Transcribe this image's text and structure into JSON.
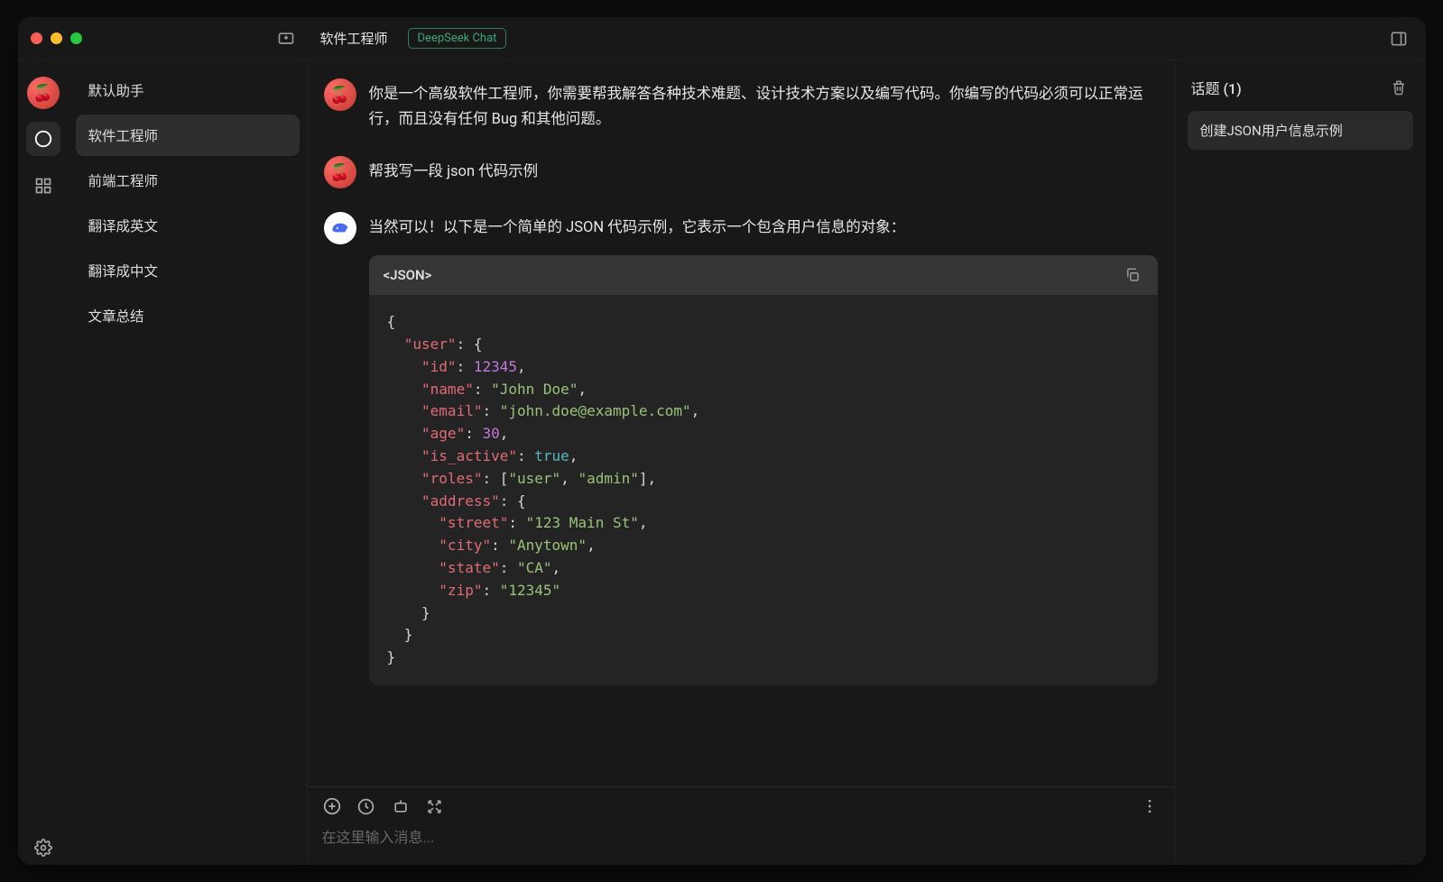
{
  "header": {
    "title": "软件工程师",
    "model_badge": "DeepSeek Chat"
  },
  "assistants": [
    {
      "label": "默认助手",
      "active": false
    },
    {
      "label": "软件工程师",
      "active": true
    },
    {
      "label": "前端工程师",
      "active": false
    },
    {
      "label": "翻译成英文",
      "active": false
    },
    {
      "label": "翻译成中文",
      "active": false
    },
    {
      "label": "文章总结",
      "active": false
    }
  ],
  "messages": {
    "m0_system": "你是一个高级软件工程师，你需要帮我解答各种技术难题、设计技术方案以及编写代码。你编写的代码必须可以正常运行，而且没有任何 Bug 和其他问题。",
    "m1_user": "帮我写一段 json 代码示例",
    "m2_assistant_intro": "当然可以！以下是一个简单的 JSON 代码示例，它表示一个包含用户信息的对象：",
    "code_label": "<JSON>",
    "code_example": {
      "user": {
        "id": 12345,
        "name": "John Doe",
        "email": "john.doe@example.com",
        "age": 30,
        "is_active": true,
        "roles": [
          "user",
          "admin"
        ],
        "address": {
          "street": "123 Main St",
          "city": "Anytown",
          "state": "CA",
          "zip": "12345"
        }
      }
    }
  },
  "input": {
    "placeholder": "在这里输入消息..."
  },
  "topics": {
    "header": "话题 (1)",
    "items": [
      {
        "label": "创建JSON用户信息示例"
      }
    ]
  }
}
